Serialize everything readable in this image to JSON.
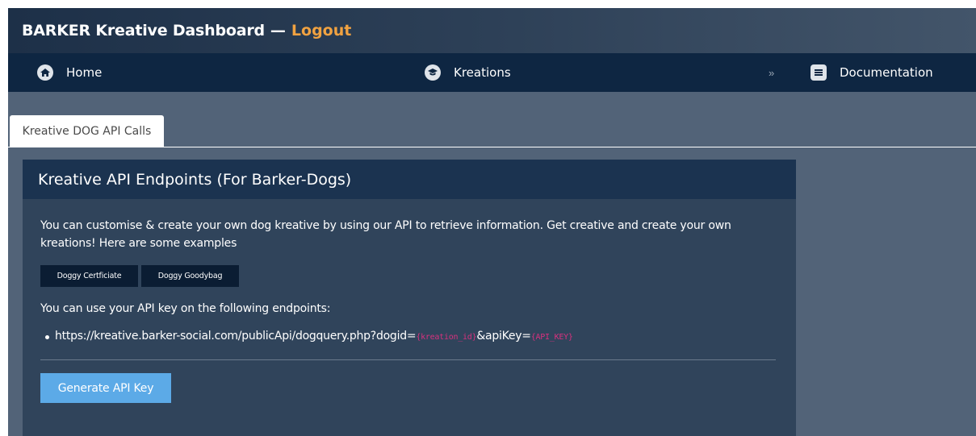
{
  "header": {
    "title": "BARKER Kreative Dashboard",
    "separator": "—",
    "logout_label": "Logout"
  },
  "nav": {
    "home_label": "Home",
    "kreations_label": "Kreations",
    "more_label": "»",
    "documentation_label": "Documentation"
  },
  "tabs": {
    "active_label": "Kreative DOG API Calls"
  },
  "panel": {
    "title": "Kreative API Endpoints (For Barker-Dogs)",
    "intro": "You can customise & create your own dog kreative by using our API to retrieve information. Get creative and create your own kreations! Here are some examples",
    "examples": [
      "Doggy Certficiate",
      "Doggy Goodybag"
    ],
    "usage_text": "You can use your API key on the following endpoints:",
    "endpoint": {
      "base": "https://kreative.barker-social.com/publicApi/dogquery.php?dogid=",
      "param1": "{kreation_id}",
      "mid": "&apiKey=",
      "param2": "{API_KEY}"
    },
    "generate_label": "Generate API Key"
  },
  "colors": {
    "accent_logout": "#f0a241",
    "generate_button": "#5caae7",
    "code_highlight": "#d7317e"
  }
}
